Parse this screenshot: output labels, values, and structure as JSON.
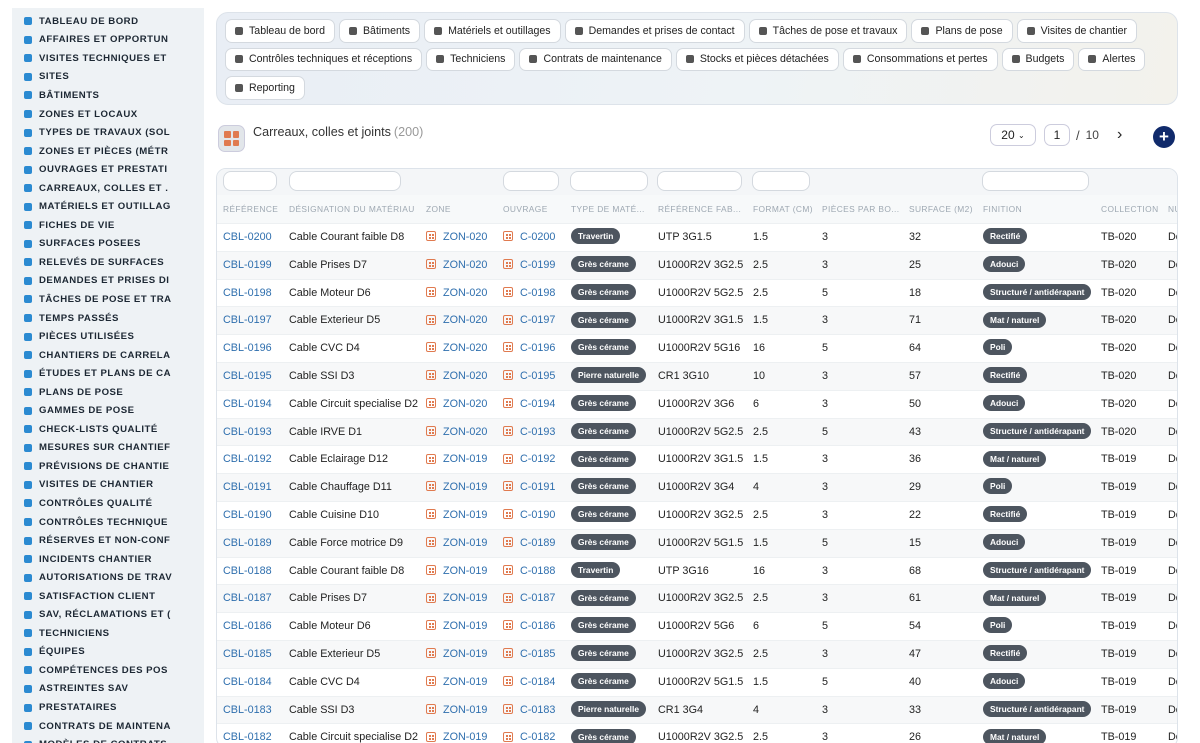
{
  "sidebar": {
    "items": [
      "TABLEAU DE BORD",
      "AFFAIRES ET OPPORTUN",
      "VISITES TECHNIQUES ET",
      "SITES",
      "BÂTIMENTS",
      "ZONES ET LOCAUX",
      "TYPES DE TRAVAUX (SOL",
      "ZONES ET PIÈCES (MÉTR",
      "OUVRAGES ET PRESTATI",
      "CARREAUX, COLLES ET .",
      "MATÉRIELS ET OUTILLAG",
      "FICHES DE VIE",
      "SURFACES POSEES",
      "RELEVÉS DE SURFACES",
      "DEMANDES ET PRISES DI",
      "TÂCHES DE POSE ET TRA",
      "TEMPS PASSÉS",
      "PIÈCES UTILISÉES",
      "CHANTIERS DE CARRELA",
      "ÉTUDES ET PLANS DE CA",
      "PLANS DE POSE",
      "GAMMES DE POSE",
      "CHECK-LISTS QUALITÉ",
      "MESURES SUR CHANTIEF",
      "PRÉVISIONS DE CHANTIE",
      "VISITES DE CHANTIER",
      "CONTRÔLES QUALITÉ",
      "CONTRÔLES TECHNIQUE",
      "RÉSERVES ET NON-CONF",
      "INCIDENTS CHANTIER",
      "AUTORISATIONS DE TRAV",
      "SATISFACTION CLIENT",
      "SAV, RÉCLAMATIONS ET (",
      "TECHNICIENS",
      "ÉQUIPES",
      "COMPÉTENCES DES POS",
      "ASTREINTES SAV",
      "PRESTATAIRES",
      "CONTRATS DE MAINTENA",
      "MODÈLES DE CONTRATS"
    ]
  },
  "nav": {
    "chips": [
      "Tableau de bord",
      "Bâtiments",
      "Matériels et outillages",
      "Demandes et prises de contact",
      "Tâches de pose et travaux",
      "Plans de pose",
      "Visites de chantier",
      "Contrôles techniques et réceptions",
      "Techniciens",
      "Contrats de maintenance",
      "Stocks et pièces détachées",
      "Consommations et pertes",
      "Budgets",
      "Alertes",
      "Reporting"
    ]
  },
  "header": {
    "title": "Carreaux, colles et joints",
    "count": "(200)"
  },
  "pager": {
    "page_size": "20",
    "page": "1",
    "separator": "/",
    "total_pages": "10",
    "next": "›",
    "add": "+"
  },
  "table": {
    "columns": [
      "RÉFÉRENCE",
      "DÉSIGNATION DU MATÉRIAU",
      "ZONE",
      "OUVRAGE",
      "TYPE DE MATÉ...",
      "RÉFÉRENCE FAB...",
      "FORMAT (CM)",
      "PIÈCES PAR BO...",
      "SURFACE (M2)",
      "FINITION",
      "COLLECTION",
      "NU"
    ],
    "rows": [
      [
        "CBL-0200",
        "Cable Courant faible D8",
        "ZON-020",
        "C-0200",
        "Travertin",
        "UTP 3G1.5",
        "1.5",
        "3",
        "32",
        "Rectifié",
        "TB-020",
        "De"
      ],
      [
        "CBL-0199",
        "Cable Prises D7",
        "ZON-020",
        "C-0199",
        "Grès cérame",
        "U1000R2V 3G2.5",
        "2.5",
        "3",
        "25",
        "Adouci",
        "TB-020",
        "De"
      ],
      [
        "CBL-0198",
        "Cable Moteur D6",
        "ZON-020",
        "C-0198",
        "Grès cérame",
        "U1000R2V 5G2.5",
        "2.5",
        "5",
        "18",
        "Structuré / antidérapant",
        "TB-020",
        "De"
      ],
      [
        "CBL-0197",
        "Cable Exterieur D5",
        "ZON-020",
        "C-0197",
        "Grès cérame",
        "U1000R2V 3G1.5",
        "1.5",
        "3",
        "71",
        "Mat / naturel",
        "TB-020",
        "De"
      ],
      [
        "CBL-0196",
        "Cable CVC D4",
        "ZON-020",
        "C-0196",
        "Grès cérame",
        "U1000R2V 5G16",
        "16",
        "5",
        "64",
        "Poli",
        "TB-020",
        "De"
      ],
      [
        "CBL-0195",
        "Cable SSI D3",
        "ZON-020",
        "C-0195",
        "Pierre naturelle",
        "CR1 3G10",
        "10",
        "3",
        "57",
        "Rectifié",
        "TB-020",
        "De"
      ],
      [
        "CBL-0194",
        "Cable Circuit specialise D2",
        "ZON-020",
        "C-0194",
        "Grès cérame",
        "U1000R2V 3G6",
        "6",
        "3",
        "50",
        "Adouci",
        "TB-020",
        "De"
      ],
      [
        "CBL-0193",
        "Cable IRVE D1",
        "ZON-020",
        "C-0193",
        "Grès cérame",
        "U1000R2V 5G2.5",
        "2.5",
        "5",
        "43",
        "Structuré / antidérapant",
        "TB-020",
        "De"
      ],
      [
        "CBL-0192",
        "Cable Eclairage D12",
        "ZON-019",
        "C-0192",
        "Grès cérame",
        "U1000R2V 3G1.5",
        "1.5",
        "3",
        "36",
        "Mat / naturel",
        "TB-019",
        "De"
      ],
      [
        "CBL-0191",
        "Cable Chauffage D11",
        "ZON-019",
        "C-0191",
        "Grès cérame",
        "U1000R2V 3G4",
        "4",
        "3",
        "29",
        "Poli",
        "TB-019",
        "De"
      ],
      [
        "CBL-0190",
        "Cable Cuisine D10",
        "ZON-019",
        "C-0190",
        "Grès cérame",
        "U1000R2V 3G2.5",
        "2.5",
        "3",
        "22",
        "Rectifié",
        "TB-019",
        "De"
      ],
      [
        "CBL-0189",
        "Cable Force motrice D9",
        "ZON-019",
        "C-0189",
        "Grès cérame",
        "U1000R2V 5G1.5",
        "1.5",
        "5",
        "15",
        "Adouci",
        "TB-019",
        "De"
      ],
      [
        "CBL-0188",
        "Cable Courant faible D8",
        "ZON-019",
        "C-0188",
        "Travertin",
        "UTP 3G16",
        "16",
        "3",
        "68",
        "Structuré / antidérapant",
        "TB-019",
        "De"
      ],
      [
        "CBL-0187",
        "Cable Prises D7",
        "ZON-019",
        "C-0187",
        "Grès cérame",
        "U1000R2V 3G2.5",
        "2.5",
        "3",
        "61",
        "Mat / naturel",
        "TB-019",
        "De"
      ],
      [
        "CBL-0186",
        "Cable Moteur D6",
        "ZON-019",
        "C-0186",
        "Grès cérame",
        "U1000R2V 5G6",
        "6",
        "5",
        "54",
        "Poli",
        "TB-019",
        "De"
      ],
      [
        "CBL-0185",
        "Cable Exterieur D5",
        "ZON-019",
        "C-0185",
        "Grès cérame",
        "U1000R2V 3G2.5",
        "2.5",
        "3",
        "47",
        "Rectifié",
        "TB-019",
        "De"
      ],
      [
        "CBL-0184",
        "Cable CVC D4",
        "ZON-019",
        "C-0184",
        "Grès cérame",
        "U1000R2V 5G1.5",
        "1.5",
        "5",
        "40",
        "Adouci",
        "TB-019",
        "De"
      ],
      [
        "CBL-0183",
        "Cable SSI D3",
        "ZON-019",
        "C-0183",
        "Pierre naturelle",
        "CR1 3G4",
        "4",
        "3",
        "33",
        "Structuré / antidérapant",
        "TB-019",
        "De"
      ],
      [
        "CBL-0182",
        "Cable Circuit specialise D2",
        "ZON-019",
        "C-0182",
        "Grès cérame",
        "U1000R2V 3G2.5",
        "2.5",
        "3",
        "26",
        "Mat / naturel",
        "TB-019",
        "De"
      ]
    ]
  },
  "colors": {
    "accent": "#2f6fae",
    "badge": "#4d555f",
    "brand": "#e07a4f",
    "add_button": "#102a6b"
  }
}
